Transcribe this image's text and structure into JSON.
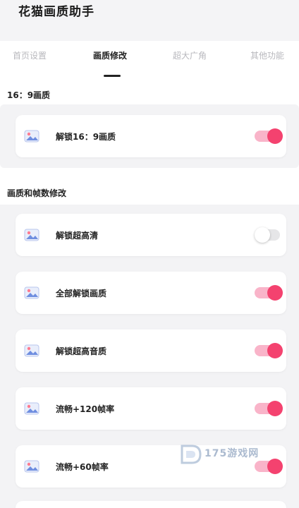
{
  "app": {
    "title": "花猫画质助手"
  },
  "tabs": [
    {
      "label": "首页设置",
      "active": false
    },
    {
      "label": "画质修改",
      "active": true
    },
    {
      "label": "超大广角",
      "active": false
    },
    {
      "label": "其他功能",
      "active": false
    }
  ],
  "sections": [
    {
      "title": "16：9画质",
      "items": [
        {
          "label": "解锁16：9画质",
          "enabled": true
        }
      ]
    },
    {
      "title": "画质和帧数修改",
      "items": [
        {
          "label": "解锁超高清",
          "enabled": false
        },
        {
          "label": "全部解锁画质",
          "enabled": true
        },
        {
          "label": "解锁超高音质",
          "enabled": true
        },
        {
          "label": "流畅+120帧率",
          "enabled": true
        },
        {
          "label": "流畅+60帧率",
          "enabled": true
        }
      ]
    }
  ],
  "watermark": {
    "text": "175游戏网"
  },
  "colors": {
    "toggle_on": "#f4426f",
    "toggle_on_track": "#f9b4c9",
    "toggle_off_track": "#e6e6e8"
  },
  "icons": {
    "item_icon": "image-icon",
    "watermark_logo": "logo-icon"
  }
}
